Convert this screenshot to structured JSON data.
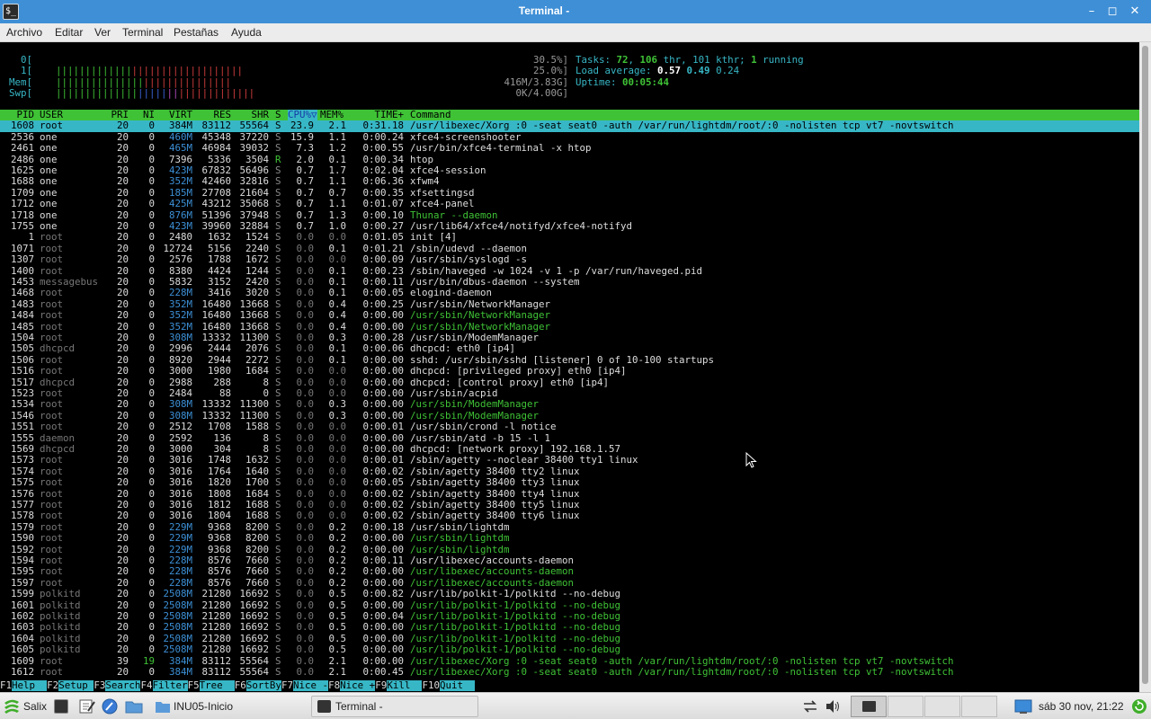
{
  "window": {
    "title": "Terminal -",
    "icon_label": "$_",
    "buttons": {
      "minimize": "–",
      "maximize": "◻",
      "close": "✕"
    }
  },
  "menu": [
    "Archivo",
    "Editar",
    "Ver",
    "Terminal",
    "Pestañas",
    "Ayuda"
  ],
  "meters": {
    "cpu0": {
      "label": "0[",
      "bar": "||||||||||||||||||||||||||||||||",
      "value": "30.5%]"
    },
    "cpu1": {
      "label": "1[",
      "bar": "||||||||||||||||||||||||||||||",
      "value": "25.0%]"
    },
    "mem": {
      "label": "Mem[",
      "bar": "||||||||||||||||||||||||||||||||",
      "value": "416M/3.83G]"
    },
    "swp": {
      "label": "Swp[",
      "value": "0K/4.00G]"
    }
  },
  "stats": {
    "tasks_label": "Tasks: ",
    "tasks": "72",
    "thr": "106",
    "thr_label": " thr, ",
    "kthr": "101 kthr; ",
    "running": "1",
    "running_label": " running",
    "load_label": "Load average: ",
    "load1": "0.57",
    "load5": "0.49",
    "load15": "0.24",
    "uptime_label": "Uptime: ",
    "uptime": "00:05:44"
  },
  "header": {
    "pid": "PID",
    "user": "USER",
    "pri": "PRI",
    "ni": "NI",
    "virt": "VIRT",
    "res": "RES",
    "shr": "SHR",
    "s": "S",
    "cpu": "CPU%▽",
    "mem": "MEM%",
    "time": "TIME+",
    "command": "Command"
  },
  "processes": [
    {
      "pid": "1608",
      "user": "root",
      "pri": "20",
      "ni": "0",
      "virt": "384M",
      "res": "83112",
      "shr": "55564",
      "s": "S",
      "cpu": "23.9",
      "mem": "2.1",
      "time": "0:31.18",
      "cmd": "/usr/libexec/Xorg :0 -seat seat0 -auth /var/run/lightdm/root/:0 -nolisten tcp vt7 -novtswitch",
      "sel": true
    },
    {
      "pid": "2536",
      "user": "one",
      "pri": "20",
      "ni": "0",
      "virt": "460M",
      "res": "45348",
      "shr": "37220",
      "s": "S",
      "cpu": "15.9",
      "mem": "1.1",
      "time": "0:00.24",
      "cmd": "xfce4-screenshooter"
    },
    {
      "pid": "2461",
      "user": "one",
      "pri": "20",
      "ni": "0",
      "virt": "465M",
      "res": "46984",
      "shr": "39032",
      "s": "S",
      "cpu": "7.3",
      "mem": "1.2",
      "time": "0:00.55",
      "cmd": "/usr/bin/xfce4-terminal -x htop"
    },
    {
      "pid": "2486",
      "user": "one",
      "pri": "20",
      "ni": "0",
      "virt": "7396",
      "res": "5336",
      "shr": "3504",
      "s": "R",
      "cpu": "2.0",
      "mem": "0.1",
      "time": "0:00.34",
      "cmd": "htop"
    },
    {
      "pid": "1625",
      "user": "one",
      "pri": "20",
      "ni": "0",
      "virt": "423M",
      "res": "67832",
      "shr": "56496",
      "s": "S",
      "cpu": "0.7",
      "mem": "1.7",
      "time": "0:02.04",
      "cmd": "xfce4-session"
    },
    {
      "pid": "1688",
      "user": "one",
      "pri": "20",
      "ni": "0",
      "virt": "352M",
      "res": "42460",
      "shr": "32816",
      "s": "S",
      "cpu": "0.7",
      "mem": "1.1",
      "time": "0:06.36",
      "cmd": "xfwm4"
    },
    {
      "pid": "1709",
      "user": "one",
      "pri": "20",
      "ni": "0",
      "virt": "185M",
      "res": "27708",
      "shr": "21604",
      "s": "S",
      "cpu": "0.7",
      "mem": "0.7",
      "time": "0:00.35",
      "cmd": "xfsettingsd"
    },
    {
      "pid": "1712",
      "user": "one",
      "pri": "20",
      "ni": "0",
      "virt": "425M",
      "res": "43212",
      "shr": "35068",
      "s": "S",
      "cpu": "0.7",
      "mem": "1.1",
      "time": "0:01.07",
      "cmd": "xfce4-panel"
    },
    {
      "pid": "1718",
      "user": "one",
      "pri": "20",
      "ni": "0",
      "virt": "876M",
      "res": "51396",
      "shr": "37948",
      "s": "S",
      "cpu": "0.7",
      "mem": "1.3",
      "time": "0:00.10",
      "cmd": "Thunar --daemon",
      "thread": true
    },
    {
      "pid": "1755",
      "user": "one",
      "pri": "20",
      "ni": "0",
      "virt": "423M",
      "res": "39960",
      "shr": "32884",
      "s": "S",
      "cpu": "0.7",
      "mem": "1.0",
      "time": "0:00.27",
      "cmd": "/usr/lib64/xfce4/notifyd/xfce4-notifyd"
    },
    {
      "pid": "1",
      "user": "root",
      "pri": "20",
      "ni": "0",
      "virt": "2480",
      "res": "1632",
      "shr": "1524",
      "s": "S",
      "cpu": "0.0",
      "mem": "0.0",
      "time": "0:01.05",
      "cmd": "init [4]"
    },
    {
      "pid": "1071",
      "user": "root",
      "pri": "20",
      "ni": "0",
      "virt": "12724",
      "res": "5156",
      "shr": "2240",
      "s": "S",
      "cpu": "0.0",
      "mem": "0.1",
      "time": "0:01.21",
      "cmd": "/sbin/udevd --daemon"
    },
    {
      "pid": "1307",
      "user": "root",
      "pri": "20",
      "ni": "0",
      "virt": "2576",
      "res": "1788",
      "shr": "1672",
      "s": "S",
      "cpu": "0.0",
      "mem": "0.0",
      "time": "0:00.09",
      "cmd": "/usr/sbin/syslogd -s"
    },
    {
      "pid": "1400",
      "user": "root",
      "pri": "20",
      "ni": "0",
      "virt": "8380",
      "res": "4424",
      "shr": "1244",
      "s": "S",
      "cpu": "0.0",
      "mem": "0.1",
      "time": "0:00.23",
      "cmd": "/sbin/haveged -w 1024 -v 1 -p /var/run/haveged.pid"
    },
    {
      "pid": "1453",
      "user": "messagebus",
      "pri": "20",
      "ni": "0",
      "virt": "5832",
      "res": "3152",
      "shr": "2420",
      "s": "S",
      "cpu": "0.0",
      "mem": "0.1",
      "time": "0:00.11",
      "cmd": "/usr/bin/dbus-daemon --system"
    },
    {
      "pid": "1468",
      "user": "root",
      "pri": "20",
      "ni": "0",
      "virt": "228M",
      "res": "3416",
      "shr": "3020",
      "s": "S",
      "cpu": "0.0",
      "mem": "0.1",
      "time": "0:00.05",
      "cmd": "elogind-daemon"
    },
    {
      "pid": "1483",
      "user": "root",
      "pri": "20",
      "ni": "0",
      "virt": "352M",
      "res": "16480",
      "shr": "13668",
      "s": "S",
      "cpu": "0.0",
      "mem": "0.4",
      "time": "0:00.25",
      "cmd": "/usr/sbin/NetworkManager"
    },
    {
      "pid": "1484",
      "user": "root",
      "pri": "20",
      "ni": "0",
      "virt": "352M",
      "res": "16480",
      "shr": "13668",
      "s": "S",
      "cpu": "0.0",
      "mem": "0.4",
      "time": "0:00.00",
      "cmd": "/usr/sbin/NetworkManager",
      "thread": true
    },
    {
      "pid": "1485",
      "user": "root",
      "pri": "20",
      "ni": "0",
      "virt": "352M",
      "res": "16480",
      "shr": "13668",
      "s": "S",
      "cpu": "0.0",
      "mem": "0.4",
      "time": "0:00.00",
      "cmd": "/usr/sbin/NetworkManager",
      "thread": true
    },
    {
      "pid": "1504",
      "user": "root",
      "pri": "20",
      "ni": "0",
      "virt": "308M",
      "res": "13332",
      "shr": "11300",
      "s": "S",
      "cpu": "0.0",
      "mem": "0.3",
      "time": "0:00.28",
      "cmd": "/usr/sbin/ModemManager"
    },
    {
      "pid": "1505",
      "user": "dhcpcd",
      "pri": "20",
      "ni": "0",
      "virt": "2996",
      "res": "2444",
      "shr": "2076",
      "s": "S",
      "cpu": "0.0",
      "mem": "0.1",
      "time": "0:00.06",
      "cmd": "dhcpcd: eth0 [ip4]"
    },
    {
      "pid": "1506",
      "user": "root",
      "pri": "20",
      "ni": "0",
      "virt": "8920",
      "res": "2944",
      "shr": "2272",
      "s": "S",
      "cpu": "0.0",
      "mem": "0.1",
      "time": "0:00.00",
      "cmd": "sshd: /usr/sbin/sshd [listener] 0 of 10-100 startups"
    },
    {
      "pid": "1516",
      "user": "root",
      "pri": "20",
      "ni": "0",
      "virt": "3000",
      "res": "1980",
      "shr": "1684",
      "s": "S",
      "cpu": "0.0",
      "mem": "0.0",
      "time": "0:00.00",
      "cmd": "dhcpcd: [privileged proxy] eth0 [ip4]"
    },
    {
      "pid": "1517",
      "user": "dhcpcd",
      "pri": "20",
      "ni": "0",
      "virt": "2988",
      "res": "288",
      "shr": "8",
      "s": "S",
      "cpu": "0.0",
      "mem": "0.0",
      "time": "0:00.00",
      "cmd": "dhcpcd: [control proxy] eth0 [ip4]"
    },
    {
      "pid": "1523",
      "user": "root",
      "pri": "20",
      "ni": "0",
      "virt": "2484",
      "res": "88",
      "shr": "0",
      "s": "S",
      "cpu": "0.0",
      "mem": "0.0",
      "time": "0:00.00",
      "cmd": "/usr/sbin/acpid"
    },
    {
      "pid": "1534",
      "user": "root",
      "pri": "20",
      "ni": "0",
      "virt": "308M",
      "res": "13332",
      "shr": "11300",
      "s": "S",
      "cpu": "0.0",
      "mem": "0.3",
      "time": "0:00.00",
      "cmd": "/usr/sbin/ModemManager",
      "thread": true
    },
    {
      "pid": "1546",
      "user": "root",
      "pri": "20",
      "ni": "0",
      "virt": "308M",
      "res": "13332",
      "shr": "11300",
      "s": "S",
      "cpu": "0.0",
      "mem": "0.3",
      "time": "0:00.00",
      "cmd": "/usr/sbin/ModemManager",
      "thread": true
    },
    {
      "pid": "1551",
      "user": "root",
      "pri": "20",
      "ni": "0",
      "virt": "2512",
      "res": "1708",
      "shr": "1588",
      "s": "S",
      "cpu": "0.0",
      "mem": "0.0",
      "time": "0:00.01",
      "cmd": "/usr/sbin/crond -l notice"
    },
    {
      "pid": "1555",
      "user": "daemon",
      "pri": "20",
      "ni": "0",
      "virt": "2592",
      "res": "136",
      "shr": "8",
      "s": "S",
      "cpu": "0.0",
      "mem": "0.0",
      "time": "0:00.00",
      "cmd": "/usr/sbin/atd -b 15 -l 1"
    },
    {
      "pid": "1569",
      "user": "dhcpcd",
      "pri": "20",
      "ni": "0",
      "virt": "3000",
      "res": "304",
      "shr": "8",
      "s": "S",
      "cpu": "0.0",
      "mem": "0.0",
      "time": "0:00.00",
      "cmd": "dhcpcd: [network proxy] 192.168.1.57"
    },
    {
      "pid": "1573",
      "user": "root",
      "pri": "20",
      "ni": "0",
      "virt": "3016",
      "res": "1748",
      "shr": "1632",
      "s": "S",
      "cpu": "0.0",
      "mem": "0.0",
      "time": "0:00.01",
      "cmd": "/sbin/agetty --noclear 38400 tty1 linux"
    },
    {
      "pid": "1574",
      "user": "root",
      "pri": "20",
      "ni": "0",
      "virt": "3016",
      "res": "1764",
      "shr": "1640",
      "s": "S",
      "cpu": "0.0",
      "mem": "0.0",
      "time": "0:00.02",
      "cmd": "/sbin/agetty 38400 tty2 linux"
    },
    {
      "pid": "1575",
      "user": "root",
      "pri": "20",
      "ni": "0",
      "virt": "3016",
      "res": "1820",
      "shr": "1700",
      "s": "S",
      "cpu": "0.0",
      "mem": "0.0",
      "time": "0:00.05",
      "cmd": "/sbin/agetty 38400 tty3 linux"
    },
    {
      "pid": "1576",
      "user": "root",
      "pri": "20",
      "ni": "0",
      "virt": "3016",
      "res": "1808",
      "shr": "1684",
      "s": "S",
      "cpu": "0.0",
      "mem": "0.0",
      "time": "0:00.02",
      "cmd": "/sbin/agetty 38400 tty4 linux"
    },
    {
      "pid": "1577",
      "user": "root",
      "pri": "20",
      "ni": "0",
      "virt": "3016",
      "res": "1812",
      "shr": "1688",
      "s": "S",
      "cpu": "0.0",
      "mem": "0.0",
      "time": "0:00.02",
      "cmd": "/sbin/agetty 38400 tty5 linux"
    },
    {
      "pid": "1578",
      "user": "root",
      "pri": "20",
      "ni": "0",
      "virt": "3016",
      "res": "1804",
      "shr": "1688",
      "s": "S",
      "cpu": "0.0",
      "mem": "0.0",
      "time": "0:00.02",
      "cmd": "/sbin/agetty 38400 tty6 linux"
    },
    {
      "pid": "1579",
      "user": "root",
      "pri": "20",
      "ni": "0",
      "virt": "229M",
      "res": "9368",
      "shr": "8200",
      "s": "S",
      "cpu": "0.0",
      "mem": "0.2",
      "time": "0:00.18",
      "cmd": "/usr/sbin/lightdm"
    },
    {
      "pid": "1590",
      "user": "root",
      "pri": "20",
      "ni": "0",
      "virt": "229M",
      "res": "9368",
      "shr": "8200",
      "s": "S",
      "cpu": "0.0",
      "mem": "0.2",
      "time": "0:00.00",
      "cmd": "/usr/sbin/lightdm",
      "thread": true
    },
    {
      "pid": "1592",
      "user": "root",
      "pri": "20",
      "ni": "0",
      "virt": "229M",
      "res": "9368",
      "shr": "8200",
      "s": "S",
      "cpu": "0.0",
      "mem": "0.2",
      "time": "0:00.00",
      "cmd": "/usr/sbin/lightdm",
      "thread": true
    },
    {
      "pid": "1594",
      "user": "root",
      "pri": "20",
      "ni": "0",
      "virt": "228M",
      "res": "8576",
      "shr": "7660",
      "s": "S",
      "cpu": "0.0",
      "mem": "0.2",
      "time": "0:00.11",
      "cmd": "/usr/libexec/accounts-daemon"
    },
    {
      "pid": "1595",
      "user": "root",
      "pri": "20",
      "ni": "0",
      "virt": "228M",
      "res": "8576",
      "shr": "7660",
      "s": "S",
      "cpu": "0.0",
      "mem": "0.2",
      "time": "0:00.00",
      "cmd": "/usr/libexec/accounts-daemon",
      "thread": true
    },
    {
      "pid": "1597",
      "user": "root",
      "pri": "20",
      "ni": "0",
      "virt": "228M",
      "res": "8576",
      "shr": "7660",
      "s": "S",
      "cpu": "0.0",
      "mem": "0.2",
      "time": "0:00.00",
      "cmd": "/usr/libexec/accounts-daemon",
      "thread": true
    },
    {
      "pid": "1599",
      "user": "polkitd",
      "pri": "20",
      "ni": "0",
      "virt": "2508M",
      "res": "21280",
      "shr": "16692",
      "s": "S",
      "cpu": "0.0",
      "mem": "0.5",
      "time": "0:00.82",
      "cmd": "/usr/lib/polkit-1/polkitd --no-debug"
    },
    {
      "pid": "1601",
      "user": "polkitd",
      "pri": "20",
      "ni": "0",
      "virt": "2508M",
      "res": "21280",
      "shr": "16692",
      "s": "S",
      "cpu": "0.0",
      "mem": "0.5",
      "time": "0:00.00",
      "cmd": "/usr/lib/polkit-1/polkitd --no-debug",
      "thread": true
    },
    {
      "pid": "1602",
      "user": "polkitd",
      "pri": "20",
      "ni": "0",
      "virt": "2508M",
      "res": "21280",
      "shr": "16692",
      "s": "S",
      "cpu": "0.0",
      "mem": "0.5",
      "time": "0:00.04",
      "cmd": "/usr/lib/polkit-1/polkitd --no-debug",
      "thread": true
    },
    {
      "pid": "1603",
      "user": "polkitd",
      "pri": "20",
      "ni": "0",
      "virt": "2508M",
      "res": "21280",
      "shr": "16692",
      "s": "S",
      "cpu": "0.0",
      "mem": "0.5",
      "time": "0:00.00",
      "cmd": "/usr/lib/polkit-1/polkitd --no-debug",
      "thread": true
    },
    {
      "pid": "1604",
      "user": "polkitd",
      "pri": "20",
      "ni": "0",
      "virt": "2508M",
      "res": "21280",
      "shr": "16692",
      "s": "S",
      "cpu": "0.0",
      "mem": "0.5",
      "time": "0:00.00",
      "cmd": "/usr/lib/polkit-1/polkitd --no-debug",
      "thread": true
    },
    {
      "pid": "1605",
      "user": "polkitd",
      "pri": "20",
      "ni": "0",
      "virt": "2508M",
      "res": "21280",
      "shr": "16692",
      "s": "S",
      "cpu": "0.0",
      "mem": "0.5",
      "time": "0:00.00",
      "cmd": "/usr/lib/polkit-1/polkitd --no-debug",
      "thread": true
    },
    {
      "pid": "1609",
      "user": "root",
      "pri": "39",
      "ni": "19",
      "virt": "384M",
      "res": "83112",
      "shr": "55564",
      "s": "S",
      "cpu": "0.0",
      "mem": "2.1",
      "time": "0:00.00",
      "cmd": "/usr/libexec/Xorg :0 -seat seat0 -auth /var/run/lightdm/root/:0 -nolisten tcp vt7 -novtswitch",
      "thread": true
    },
    {
      "pid": "1612",
      "user": "root",
      "pri": "20",
      "ni": "0",
      "virt": "384M",
      "res": "83112",
      "shr": "55564",
      "s": "S",
      "cpu": "0.0",
      "mem": "2.1",
      "time": "0:00.45",
      "cmd": "/usr/libexec/Xorg :0 -seat seat0 -auth /var/run/lightdm/root/:0 -nolisten tcp vt7 -novtswitch",
      "thread": true
    }
  ],
  "fkeys": [
    {
      "key": "F1",
      "label": "Help  "
    },
    {
      "key": "F2",
      "label": "Setup "
    },
    {
      "key": "F3",
      "label": "Search"
    },
    {
      "key": "F4",
      "label": "Filter"
    },
    {
      "key": "F5",
      "label": "Tree  "
    },
    {
      "key": "F6",
      "label": "SortBy"
    },
    {
      "key": "F7",
      "label": "Nice -"
    },
    {
      "key": "F8",
      "label": "Nice +"
    },
    {
      "key": "F9",
      "label": "Kill  "
    },
    {
      "key": "F10",
      "label": "Quit  "
    }
  ],
  "taskbar": {
    "start_label": "Salix",
    "folder_task": "INU05-Inicio",
    "terminal_task": "Terminal -",
    "clock": "sáb 30 nov, 21:22"
  },
  "colors": {
    "titlebar": "#3f8fd6",
    "header_green": "#3fc236",
    "selection_cyan": "#37b7c6"
  }
}
